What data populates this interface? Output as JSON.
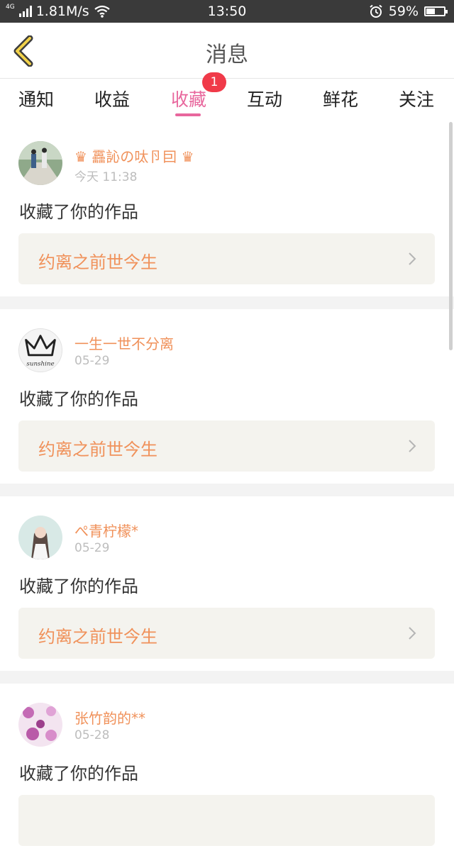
{
  "status_bar": {
    "network": "4G",
    "speed": "1.81M/s",
    "time": "13:50",
    "battery": "59%"
  },
  "header": {
    "title": "消息"
  },
  "tabs": [
    {
      "label": "通知"
    },
    {
      "label": "收益"
    },
    {
      "label": "收藏",
      "badge": "1"
    },
    {
      "label": "互动"
    },
    {
      "label": "鲜花"
    },
    {
      "label": "关注"
    }
  ],
  "notifications": [
    {
      "user": "♛ 靐訫の呔卪囙 ♛",
      "time": "今天 11:38",
      "action": "收藏了你的作品",
      "work": "约离之前世今生"
    },
    {
      "user": "一生一世不分离",
      "time": "05-29",
      "action": "收藏了你的作品",
      "work": "约离之前世今生"
    },
    {
      "user": "ぺ青柠檬*",
      "time": "05-29",
      "action": "收藏了你的作品",
      "work": "约离之前世今生"
    },
    {
      "user": "张竹韵的**",
      "time": "05-28",
      "action": "收藏了你的作品",
      "work": ""
    }
  ],
  "avatar_texts": {
    "sunshine": "sunshine"
  },
  "colors": {
    "accent_pink": "#e8679d",
    "name_orange": "#f0915a",
    "badge_red": "#f03a49",
    "card_bg": "#f4f3ee"
  }
}
